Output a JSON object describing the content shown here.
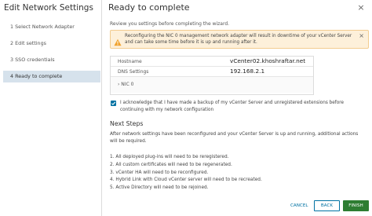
{
  "wizard": {
    "title": "Edit Network Settings",
    "steps": [
      {
        "label": "1   Select Network Adapter"
      },
      {
        "label": "2   Edit settings"
      },
      {
        "label": "3   SSO credentials"
      },
      {
        "label": "4   Ready to complete"
      }
    ]
  },
  "main": {
    "title": "Ready to complete",
    "close_glyph": "×",
    "review_text": "Review you settings before completing the wizard.",
    "warning": {
      "text": "Reconfiguring the NIC 0 management network adapter will result in downtime of your vCenter Server and can take some time before it is up and running after it.",
      "close_glyph": "×",
      "icon": "warning-triangle-icon"
    },
    "settings": {
      "hostname_label": "Hostname",
      "hostname_value": "vCenter02.khoshraftar.net",
      "dns_label": "DNS Settings",
      "dns_value": "192.168.2.1",
      "nic_label": "›  NIC 0"
    },
    "acknowledge": {
      "checked": true,
      "text": "I acknowledge that I have made a backup of my vCenter Server and unregistered extensions before continuing with my network configuration"
    },
    "next_steps": {
      "title": "Next Steps",
      "description": "After network settings have been reconfigured and your vCenter Server is up and running, additional actions will be required.",
      "items": [
        "1. All deployed plug-ins will need to be reregistered.",
        "2. All custom certificates will need to be regenerated.",
        "3. vCenter HA will need to be reconfigured.",
        "4. Hybrid Link with Cloud vCenter server will need to be recreated.",
        "5. Active Directory will need to be rejoined."
      ]
    }
  },
  "footer": {
    "cancel_label": "CANCEL",
    "back_label": "BACK",
    "finish_label": "FINISH"
  },
  "colors": {
    "accent": "#0072a3",
    "finish": "#2e7d32",
    "warning_bg": "#fdf0da",
    "active_step_bg": "#d6e2ec"
  }
}
